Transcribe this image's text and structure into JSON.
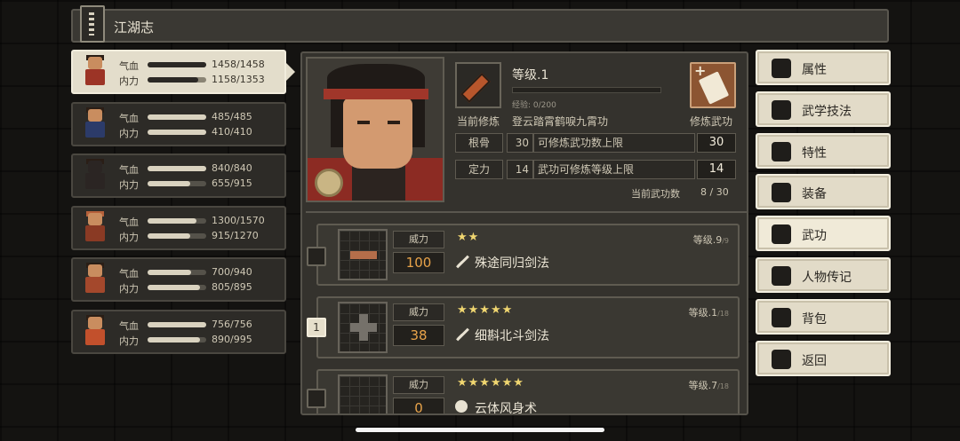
{
  "title": "江湖志",
  "characters": [
    {
      "hp_label": "气血",
      "hp": "1458/1458",
      "hp_pct": 1.0,
      "mp_label": "内力",
      "mp": "1158/1353",
      "mp_pct": 0.86,
      "selected": true
    },
    {
      "hp_label": "气血",
      "hp": "485/485",
      "hp_pct": 1.0,
      "mp_label": "内力",
      "mp": "410/410",
      "mp_pct": 1.0
    },
    {
      "hp_label": "气血",
      "hp": "840/840",
      "hp_pct": 1.0,
      "mp_label": "内力",
      "mp": "655/915",
      "mp_pct": 0.72
    },
    {
      "hp_label": "气血",
      "hp": "1300/1570",
      "hp_pct": 0.83,
      "mp_label": "内力",
      "mp": "915/1270",
      "mp_pct": 0.72
    },
    {
      "hp_label": "气血",
      "hp": "700/940",
      "hp_pct": 0.74,
      "mp_label": "内力",
      "mp": "805/895",
      "mp_pct": 0.9
    },
    {
      "hp_label": "气血",
      "hp": "756/756",
      "hp_pct": 1.0,
      "mp_label": "内力",
      "mp": "890/995",
      "mp_pct": 0.89
    }
  ],
  "detail": {
    "level": "等级.1",
    "exp": "经验: 0/200",
    "current_training_label": "当前修炼",
    "current_training_name": "登云踏霄鹤唳九霄功",
    "train_button_label": "修炼武功",
    "rows": [
      {
        "name": "根骨",
        "num": "30",
        "desc": "可修炼武功数上限",
        "value": "30"
      },
      {
        "name": "定力",
        "num": "14",
        "desc": "武功可修炼等级上限",
        "value": "14"
      }
    ],
    "count_label": "当前武功数",
    "count_value": "8 / 30"
  },
  "skills": [
    {
      "power_label": "威力",
      "power": "100",
      "stars": "★★",
      "level": "等级.9",
      "level_max": "/9",
      "name": "殊途同归剑法",
      "icon": "sword-icon",
      "slot": ""
    },
    {
      "power_label": "威力",
      "power": "38",
      "stars": "★★★★★",
      "level": "等级.1",
      "level_max": "/18",
      "name": "细斟北斗剑法",
      "icon": "sword-icon",
      "slot": "1"
    },
    {
      "power_label": "威力",
      "power": "0",
      "stars": "★★★★★★",
      "level": "等级.7",
      "level_max": "/18",
      "name": "云体风身术",
      "icon": "swirl-icon",
      "slot": ""
    }
  ],
  "menu": [
    {
      "label": "属性",
      "icon": "attribute-icon"
    },
    {
      "label": "武学技法",
      "icon": "martial-technique-icon"
    },
    {
      "label": "特性",
      "icon": "trait-icon"
    },
    {
      "label": "装备",
      "icon": "sword-icon"
    },
    {
      "label": "武功",
      "icon": "scroll-icon",
      "active": true
    },
    {
      "label": "人物传记",
      "icon": "biography-icon"
    },
    {
      "label": "背包",
      "icon": "bag-icon"
    },
    {
      "label": "返回",
      "icon": "door-icon"
    }
  ],
  "colors": {
    "accent_orange": "#e8a34a",
    "star": "#f0d670",
    "menu_bg": "#e2dbc8"
  }
}
